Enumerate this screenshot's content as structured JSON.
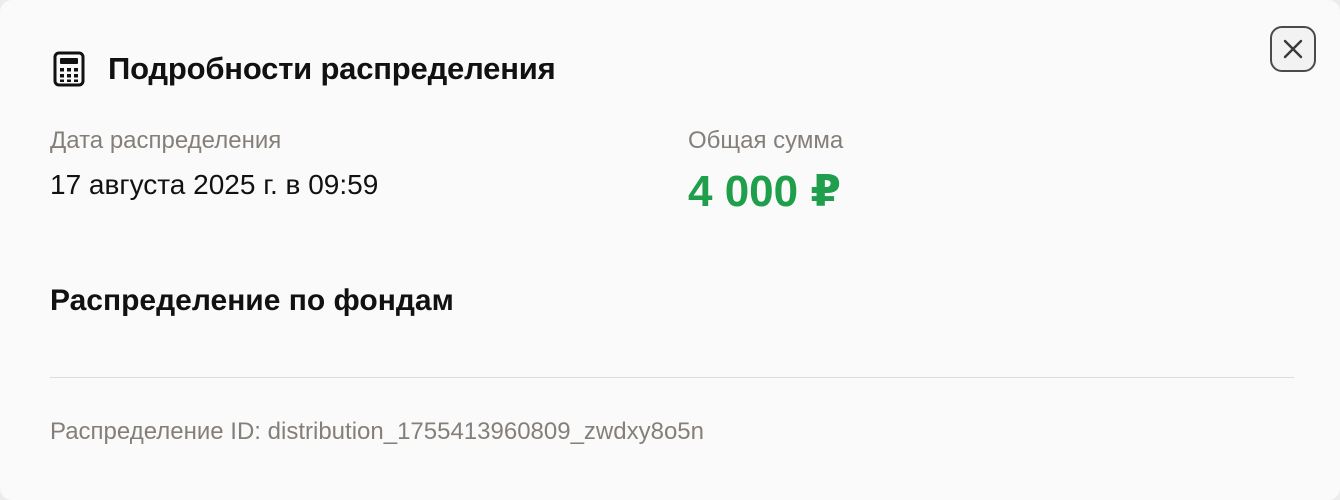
{
  "dialog": {
    "title": "Подробности распределения",
    "header_icon": "calculator-icon",
    "close_icon": "close-icon"
  },
  "details": {
    "date_label": "Дата распределения",
    "date_value": "17 августа 2025 г. в 09:59",
    "total_label": "Общая сумма",
    "total_value": "4 000 ₽",
    "total_color": "#1f9e4b"
  },
  "funds_section": {
    "title": "Распределение по фондам"
  },
  "footer": {
    "id_prefix": "Распределение ID:",
    "id_value": "distribution_1755413960809_zwdxy8o5n"
  }
}
